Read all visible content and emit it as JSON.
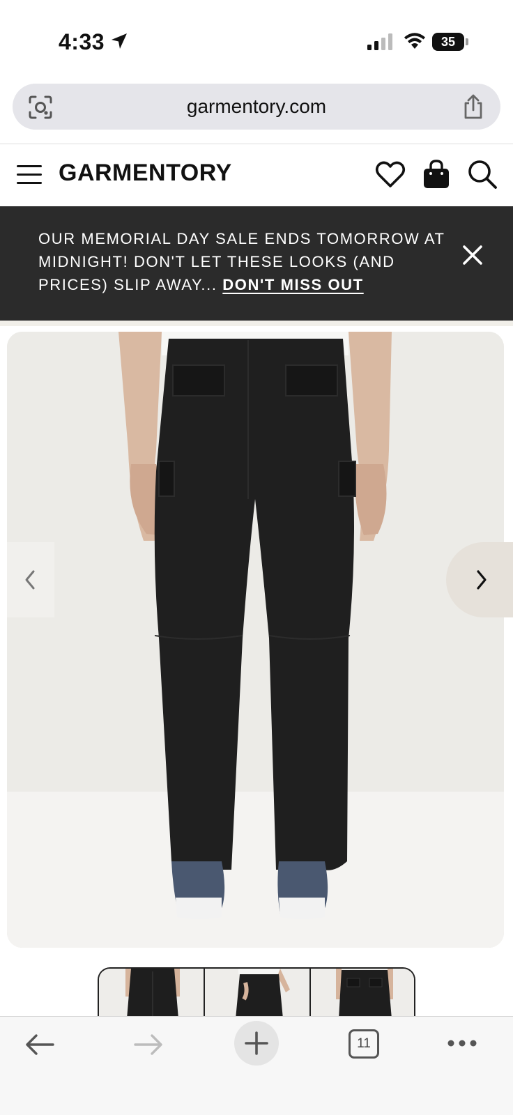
{
  "status_bar": {
    "time": "4:33",
    "battery": "35"
  },
  "browser": {
    "url": "garmentory.com",
    "tab_count": "11"
  },
  "site": {
    "brand": "GARMENTORY"
  },
  "promo": {
    "text": "OUR MEMORIAL DAY SALE ENDS TOMORROW AT MIDNIGHT! DON'T LET THESE LOOKS (AND PRICES) SLIP AWAY...",
    "link": "DON'T MISS OUT"
  },
  "product": {
    "image_alt": "Black cargo pants, rear view",
    "thumbnail_count": 3
  }
}
